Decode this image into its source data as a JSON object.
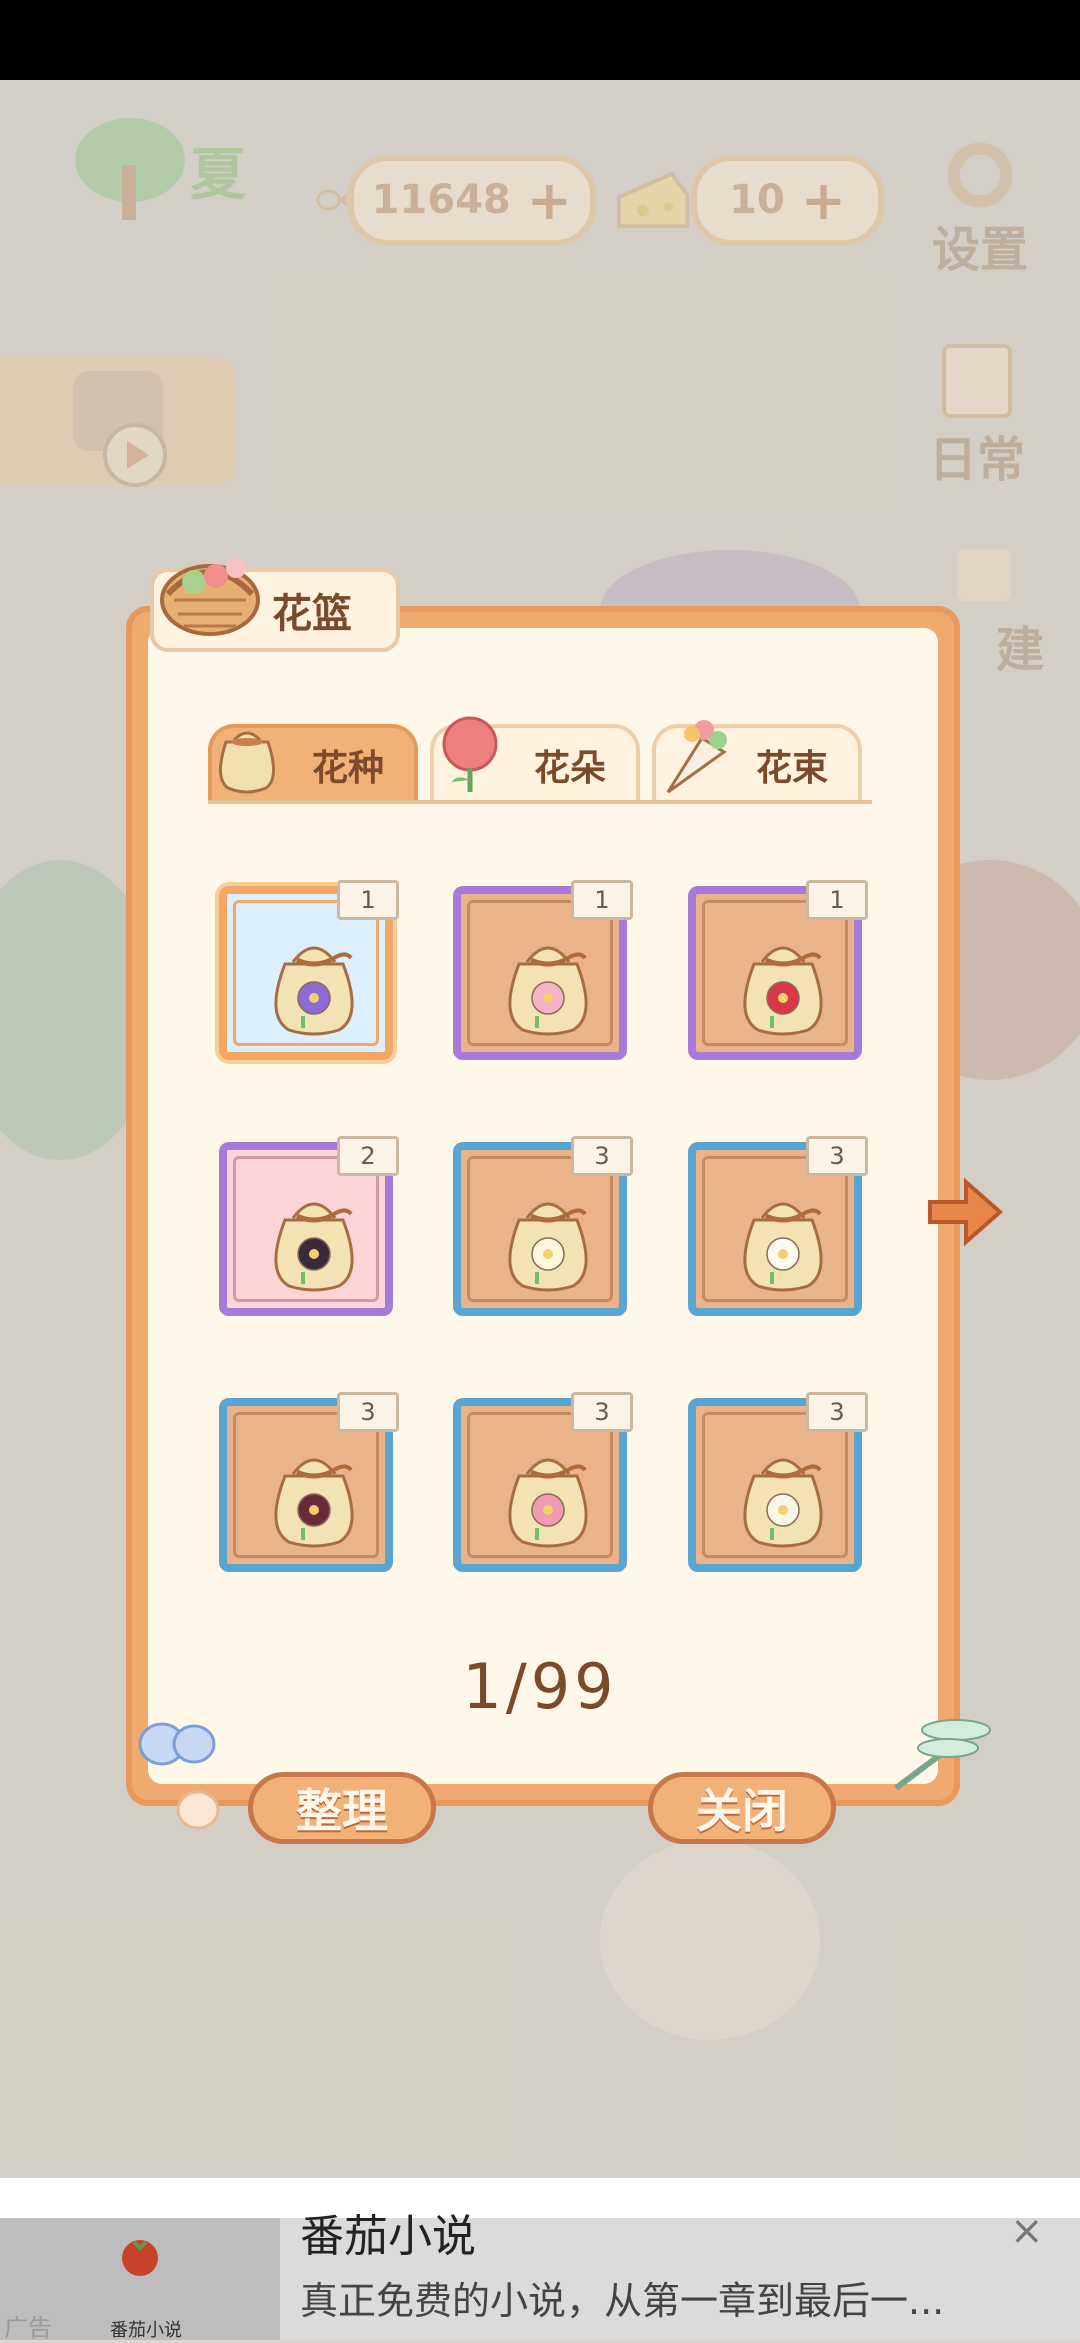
{
  "hud": {
    "season": "夏",
    "fish_count": "11648",
    "cheese_count": "10",
    "settings_label": "设置",
    "daily_label": "日常",
    "build_label": "建"
  },
  "panel": {
    "title": "花篮",
    "tabs": [
      {
        "label": "花种",
        "active": true
      },
      {
        "label": "花朵",
        "active": false
      },
      {
        "label": "花束",
        "active": false
      }
    ],
    "items": [
      {
        "count": "1",
        "frame": "selected",
        "flower": "purple-aster"
      },
      {
        "count": "1",
        "frame": "purple",
        "flower": "pink-hibiscus"
      },
      {
        "count": "1",
        "frame": "purple",
        "flower": "red-camellia"
      },
      {
        "count": "2",
        "frame": "pink",
        "flower": "black-tulip"
      },
      {
        "count": "3",
        "frame": "blue",
        "flower": "white-cluster"
      },
      {
        "count": "3",
        "frame": "blue",
        "flower": "white-lily"
      },
      {
        "count": "3",
        "frame": "blue",
        "flower": "dark-chrysanthemum"
      },
      {
        "count": "3",
        "frame": "blue",
        "flower": "pink-peony"
      },
      {
        "count": "3",
        "frame": "blue",
        "flower": "white-narcissus"
      }
    ],
    "page": "1/99",
    "sort_label": "整理",
    "close_label": "关闭"
  },
  "ad": {
    "title": "番茄小说",
    "description": "真正免费的小说，从第一章到最后一...",
    "logo_text": "番茄小说",
    "tag": "广告",
    "close_icon": "×"
  },
  "colors": {
    "panel_orange": "#f0a96e",
    "panel_cream": "#fff7e8",
    "rarity_blue": "#5aa4d1",
    "rarity_purple": "#a77ad8",
    "text_brown": "#7a4a2b"
  }
}
